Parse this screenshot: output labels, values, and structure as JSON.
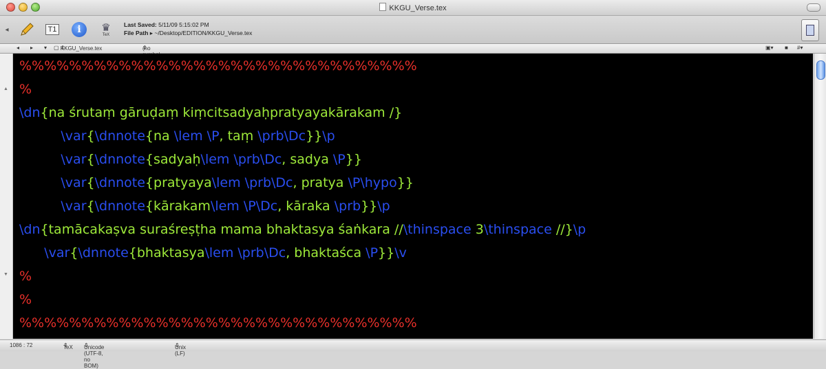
{
  "window": {
    "title": "KKGU_Verse.tex"
  },
  "toolbar": {
    "typeset_label": "TeX",
    "info_glyph": "i",
    "t1_label": "T1",
    "last_saved_label": "Last Saved:",
    "last_saved_value": "5/11/09 5:15:02 PM",
    "file_path_label": "File Path",
    "file_path_value": "~/Desktop/EDITION/KKGU_Verse.tex"
  },
  "navbar": {
    "file_name": "KKGU_Verse.tex",
    "symbol": "(no symbol selected)"
  },
  "editor": {
    "lines": [
      [
        {
          "t": "%%%%%%%%%%%%%%%%%%%%%%%%%%%%%%%%",
          "c": "r"
        }
      ],
      [
        {
          "t": "%",
          "c": "r"
        }
      ],
      [
        {
          "t": "\\dn",
          "c": "b"
        },
        {
          "t": "{na śrutaṃ gāruḍaṃ kiṃcitsadyaḥpratyayakārakam /}",
          "c": "g"
        }
      ],
      [
        {
          "t": "          ",
          "c": "g"
        },
        {
          "t": "\\var",
          "c": "b"
        },
        {
          "t": "{",
          "c": "g"
        },
        {
          "t": "\\dnnote",
          "c": "b"
        },
        {
          "t": "{na ",
          "c": "g"
        },
        {
          "t": "\\lem \\P",
          "c": "b"
        },
        {
          "t": ", taṃ ",
          "c": "g"
        },
        {
          "t": "\\prb\\Dc",
          "c": "b"
        },
        {
          "t": "}}",
          "c": "g"
        },
        {
          "t": "\\p",
          "c": "b"
        }
      ],
      [
        {
          "t": "          ",
          "c": "g"
        },
        {
          "t": "\\var",
          "c": "b"
        },
        {
          "t": "{",
          "c": "g"
        },
        {
          "t": "\\dnnote",
          "c": "b"
        },
        {
          "t": "{sadyaḥ",
          "c": "g"
        },
        {
          "t": "\\lem \\prb\\Dc",
          "c": "b"
        },
        {
          "t": ", sadya ",
          "c": "g"
        },
        {
          "t": "\\P",
          "c": "b"
        },
        {
          "t": "}}",
          "c": "g"
        }
      ],
      [
        {
          "t": "          ",
          "c": "g"
        },
        {
          "t": "\\var",
          "c": "b"
        },
        {
          "t": "{",
          "c": "g"
        },
        {
          "t": "\\dnnote",
          "c": "b"
        },
        {
          "t": "{pratyaya",
          "c": "g"
        },
        {
          "t": "\\lem \\prb\\Dc",
          "c": "b"
        },
        {
          "t": ", pratya ",
          "c": "g"
        },
        {
          "t": "\\P\\hypo",
          "c": "b"
        },
        {
          "t": "}}",
          "c": "g"
        }
      ],
      [
        {
          "t": "          ",
          "c": "g"
        },
        {
          "t": "\\var",
          "c": "b"
        },
        {
          "t": "{",
          "c": "g"
        },
        {
          "t": "\\dnnote",
          "c": "b"
        },
        {
          "t": "{kārakam",
          "c": "g"
        },
        {
          "t": "\\lem \\P\\Dc",
          "c": "b"
        },
        {
          "t": ", kāraka ",
          "c": "g"
        },
        {
          "t": "\\prb",
          "c": "b"
        },
        {
          "t": "}}",
          "c": "g"
        },
        {
          "t": "\\p",
          "c": "b"
        }
      ],
      [
        {
          "t": "\\dn",
          "c": "b"
        },
        {
          "t": "{tamācakaṣva suraśreṣṭha mama bhaktasya śaṅkara //",
          "c": "g"
        },
        {
          "t": "\\thinspace ",
          "c": "b"
        },
        {
          "t": "3",
          "c": "g"
        },
        {
          "t": "\\thinspace ",
          "c": "b"
        },
        {
          "t": "//}",
          "c": "g"
        },
        {
          "t": "\\p",
          "c": "b"
        }
      ],
      [
        {
          "t": "      ",
          "c": "g"
        },
        {
          "t": "\\var",
          "c": "b"
        },
        {
          "t": "{",
          "c": "g"
        },
        {
          "t": "\\dnnote",
          "c": "b"
        },
        {
          "t": "{bhaktasya",
          "c": "g"
        },
        {
          "t": "\\lem \\prb\\Dc",
          "c": "b"
        },
        {
          "t": ", bhaktaśca ",
          "c": "g"
        },
        {
          "t": "\\P",
          "c": "b"
        },
        {
          "t": "}}",
          "c": "g"
        },
        {
          "t": "\\v",
          "c": "b"
        }
      ],
      [
        {
          "t": "%",
          "c": "r"
        }
      ],
      [
        {
          "t": "%",
          "c": "r"
        }
      ],
      [
        {
          "t": "%%%%%%%%%%%%%%%%%%%%%%%%%%%%%%%%",
          "c": "r"
        }
      ]
    ]
  },
  "statusbar": {
    "position": "1086 : 72",
    "mode": "TeX",
    "encoding": "Unicode (UTF-8, no BOM)",
    "line_endings": "Unix (LF)"
  },
  "colors": {
    "comment": "#e8302a",
    "command": "#2a4ef0",
    "text": "#9eea3a",
    "background": "#000000"
  }
}
